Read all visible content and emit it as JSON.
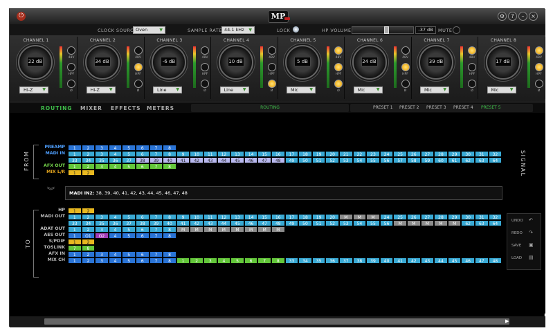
{
  "app": {
    "logo": "MP"
  },
  "topbar": {
    "clock_source_label": "CLOCK SOURCE",
    "clock_source_value": "Oven",
    "sample_rate_label": "SAMPLE RATE",
    "sample_rate_value": "44.1 kHz",
    "lock_label": "LOCK",
    "hp_volume_label": "HP VOLUME",
    "hp_volume_value": "-37 dB",
    "hp_volume_level": 0.56,
    "mute_label": "MUTE"
  },
  "channels": [
    {
      "name": "CHANNEL 1",
      "gain": "22 dB",
      "input": "Hi-Z",
      "btn48": false,
      "hpf": false,
      "phase": false
    },
    {
      "name": "CHANNEL 2",
      "gain": "34 dB",
      "input": "Hi-Z",
      "btn48": false,
      "hpf": true,
      "phase": false
    },
    {
      "name": "CHANNEL 3",
      "gain": "-6 dB",
      "input": "Line",
      "btn48": false,
      "hpf": false,
      "phase": false
    },
    {
      "name": "CHANNEL 4",
      "gain": "10 dB",
      "input": "Line",
      "btn48": false,
      "hpf": false,
      "phase": true
    },
    {
      "name": "CHANNEL 5",
      "gain": "5 dB",
      "input": "Mic",
      "btn48": true,
      "hpf": true,
      "phase": true
    },
    {
      "name": "CHANNEL 6",
      "gain": "24 dB",
      "input": "Mic",
      "btn48": false,
      "hpf": true,
      "phase": false
    },
    {
      "name": "CHANNEL 7",
      "gain": "39 dB",
      "input": "Mic",
      "btn48": true,
      "hpf": false,
      "phase": false
    },
    {
      "name": "CHANNEL 8",
      "gain": "17 dB",
      "input": "Mic",
      "btn48": true,
      "hpf": true,
      "phase": false
    }
  ],
  "channel_button_labels": {
    "p48": "48V",
    "hpf": "HPF",
    "phase": "Ø"
  },
  "tabs": [
    {
      "label": "ROUTING",
      "active": true
    },
    {
      "label": "MIXER",
      "active": false
    },
    {
      "label": "EFFECTS",
      "active": false
    },
    {
      "label": "METERS",
      "active": false
    }
  ],
  "routing_header": "ROUTING",
  "presets": [
    {
      "label": "PRESET 1",
      "active": false
    },
    {
      "label": "PRESET 2",
      "active": false
    },
    {
      "label": "PRESET 3",
      "active": false
    },
    {
      "label": "PRESET 4",
      "active": false
    },
    {
      "label": "PRESET 5",
      "active": true
    }
  ],
  "from_label": "FROM",
  "to_label": "TO",
  "signal_label": "SIGNAL",
  "colors": {
    "blue": "#2a74d6",
    "cyan": "#39a9d4",
    "lavender": "#b8b8ee",
    "green": "#63c63a",
    "yellow": "#e8b820",
    "grey": "#8c8c8c",
    "purple": "#a23db8",
    "label_blue": "#4fa0ff",
    "label_orange": "#e8a81e",
    "label_green": "#74d34a",
    "label_grey": "#bbbbbb"
  },
  "from_rows": [
    {
      "label": "PREAMP",
      "color": "#4fa0ff",
      "cells": [
        {
          "t": "1",
          "c": "blue"
        },
        {
          "t": "2",
          "c": "blue"
        },
        {
          "t": "3",
          "c": "blue"
        },
        {
          "t": "4",
          "c": "blue"
        },
        {
          "t": "5",
          "c": "blue"
        },
        {
          "t": "6",
          "c": "blue"
        },
        {
          "t": "7",
          "c": "blue"
        },
        {
          "t": "8",
          "c": "blue"
        }
      ]
    },
    {
      "label": "MADI IN",
      "color": "#4fa0ff",
      "cells": [
        {
          "t": "1",
          "c": "cyan"
        },
        {
          "t": "2",
          "c": "cyan"
        },
        {
          "t": "3",
          "c": "cyan"
        },
        {
          "t": "4",
          "c": "cyan"
        },
        {
          "t": "5",
          "c": "cyan"
        },
        {
          "t": "6",
          "c": "cyan"
        },
        {
          "t": "7",
          "c": "cyan"
        },
        {
          "t": "8",
          "c": "cyan"
        },
        {
          "t": "9",
          "c": "cyan"
        },
        {
          "t": "10",
          "c": "cyan"
        },
        {
          "t": "11",
          "c": "cyan"
        },
        {
          "t": "12",
          "c": "cyan"
        },
        {
          "t": "13",
          "c": "cyan"
        },
        {
          "t": "14",
          "c": "cyan"
        },
        {
          "t": "15",
          "c": "cyan"
        },
        {
          "t": "16",
          "c": "cyan"
        },
        {
          "t": "17",
          "c": "cyan"
        },
        {
          "t": "18",
          "c": "cyan"
        },
        {
          "t": "19",
          "c": "cyan"
        },
        {
          "t": "20",
          "c": "cyan"
        },
        {
          "t": "21",
          "c": "cyan"
        },
        {
          "t": "22",
          "c": "cyan"
        },
        {
          "t": "23",
          "c": "cyan"
        },
        {
          "t": "24",
          "c": "cyan"
        },
        {
          "t": "25",
          "c": "cyan"
        },
        {
          "t": "26",
          "c": "cyan"
        },
        {
          "t": "27",
          "c": "cyan"
        },
        {
          "t": "28",
          "c": "cyan"
        },
        {
          "t": "29",
          "c": "cyan"
        },
        {
          "t": "30",
          "c": "cyan"
        },
        {
          "t": "31",
          "c": "cyan"
        },
        {
          "t": "32",
          "c": "cyan"
        }
      ]
    },
    {
      "label": "",
      "color": "#4fa0ff",
      "cells": [
        {
          "t": "33",
          "c": "cyan"
        },
        {
          "t": "34",
          "c": "cyan"
        },
        {
          "t": "35",
          "c": "cyan"
        },
        {
          "t": "36",
          "c": "cyan"
        },
        {
          "t": "37",
          "c": "cyan"
        },
        {
          "t": "38",
          "c": "lavender"
        },
        {
          "t": "39",
          "c": "lavender"
        },
        {
          "t": "40",
          "c": "lavender"
        },
        {
          "t": "41",
          "c": "lavender"
        },
        {
          "t": "42",
          "c": "lavender"
        },
        {
          "t": "43",
          "c": "lavender"
        },
        {
          "t": "44",
          "c": "lavender"
        },
        {
          "t": "45",
          "c": "lavender"
        },
        {
          "t": "46",
          "c": "lavender"
        },
        {
          "t": "47",
          "c": "lavender"
        },
        {
          "t": "48",
          "c": "lavender"
        },
        {
          "t": "49",
          "c": "cyan"
        },
        {
          "t": "50",
          "c": "cyan"
        },
        {
          "t": "51",
          "c": "cyan"
        },
        {
          "t": "52",
          "c": "cyan"
        },
        {
          "t": "53",
          "c": "cyan"
        },
        {
          "t": "54",
          "c": "cyan"
        },
        {
          "t": "55",
          "c": "cyan"
        },
        {
          "t": "56",
          "c": "cyan"
        },
        {
          "t": "57",
          "c": "cyan"
        },
        {
          "t": "58",
          "c": "cyan"
        },
        {
          "t": "59",
          "c": "cyan"
        },
        {
          "t": "60",
          "c": "cyan"
        },
        {
          "t": "61",
          "c": "cyan"
        },
        {
          "t": "62",
          "c": "cyan"
        },
        {
          "t": "63",
          "c": "cyan"
        },
        {
          "t": "64",
          "c": "cyan"
        }
      ]
    },
    {
      "label": "AFX OUT",
      "color": "#74d34a",
      "cells": [
        {
          "t": "1",
          "c": "green"
        },
        {
          "t": "2",
          "c": "green"
        },
        {
          "t": "3",
          "c": "green"
        },
        {
          "t": "4",
          "c": "green"
        },
        {
          "t": "5",
          "c": "green"
        },
        {
          "t": "6",
          "c": "green"
        },
        {
          "t": "7",
          "c": "green"
        },
        {
          "t": "8",
          "c": "green"
        }
      ]
    },
    {
      "label": "MIX L/R",
      "color": "#e8a81e",
      "cells": [
        {
          "t": "1",
          "c": "yellow"
        },
        {
          "t": "2",
          "c": "yellow"
        }
      ]
    }
  ],
  "info_label": "MADI IN2:",
  "info_text": "38, 39, 40, 41, 42, 43, 44, 45, 46, 47, 48",
  "to_rows": [
    {
      "label": "HP",
      "color": "#bbbbbb",
      "cells": [
        {
          "t": "1",
          "c": "yellow"
        },
        {
          "t": "2",
          "c": "yellow"
        }
      ]
    },
    {
      "label": "MADI OUT",
      "color": "#bbbbbb",
      "cells": [
        {
          "t": "1",
          "c": "cyan"
        },
        {
          "t": "2",
          "c": "cyan"
        },
        {
          "t": "3",
          "c": "cyan"
        },
        {
          "t": "4",
          "c": "cyan"
        },
        {
          "t": "5",
          "c": "cyan"
        },
        {
          "t": "6",
          "c": "cyan"
        },
        {
          "t": "7",
          "c": "cyan"
        },
        {
          "t": "8",
          "c": "cyan"
        },
        {
          "t": "9",
          "c": "cyan"
        },
        {
          "t": "10",
          "c": "cyan"
        },
        {
          "t": "11",
          "c": "cyan"
        },
        {
          "t": "12",
          "c": "cyan"
        },
        {
          "t": "13",
          "c": "cyan"
        },
        {
          "t": "14",
          "c": "cyan"
        },
        {
          "t": "15",
          "c": "cyan"
        },
        {
          "t": "16",
          "c": "cyan"
        },
        {
          "t": "17",
          "c": "cyan"
        },
        {
          "t": "18",
          "c": "cyan"
        },
        {
          "t": "19",
          "c": "cyan"
        },
        {
          "t": "20",
          "c": "cyan"
        },
        {
          "t": "M",
          "c": "grey"
        },
        {
          "t": "M",
          "c": "grey"
        },
        {
          "t": "M",
          "c": "grey"
        },
        {
          "t": "24",
          "c": "cyan"
        },
        {
          "t": "25",
          "c": "cyan"
        },
        {
          "t": "26",
          "c": "cyan"
        },
        {
          "t": "27",
          "c": "cyan"
        },
        {
          "t": "28",
          "c": "cyan"
        },
        {
          "t": "29",
          "c": "cyan"
        },
        {
          "t": "30",
          "c": "cyan"
        },
        {
          "t": "31",
          "c": "cyan"
        },
        {
          "t": "32",
          "c": "cyan"
        }
      ]
    },
    {
      "label": "",
      "color": "#bbbbbb",
      "cells": [
        {
          "t": "33",
          "c": "cyan"
        },
        {
          "t": "34",
          "c": "cyan"
        },
        {
          "t": "35",
          "c": "cyan"
        },
        {
          "t": "36",
          "c": "cyan"
        },
        {
          "t": "37",
          "c": "cyan"
        },
        {
          "t": "38",
          "c": "cyan"
        },
        {
          "t": "39",
          "c": "cyan"
        },
        {
          "t": "40",
          "c": "cyan"
        },
        {
          "t": "41",
          "c": "cyan"
        },
        {
          "t": "42",
          "c": "cyan"
        },
        {
          "t": "43",
          "c": "cyan"
        },
        {
          "t": "44",
          "c": "cyan"
        },
        {
          "t": "45",
          "c": "cyan"
        },
        {
          "t": "46",
          "c": "cyan"
        },
        {
          "t": "47",
          "c": "cyan"
        },
        {
          "t": "48",
          "c": "cyan"
        },
        {
          "t": "49",
          "c": "cyan"
        },
        {
          "t": "50",
          "c": "cyan"
        },
        {
          "t": "51",
          "c": "cyan"
        },
        {
          "t": "52",
          "c": "cyan"
        },
        {
          "t": "53",
          "c": "cyan"
        },
        {
          "t": "54",
          "c": "cyan"
        },
        {
          "t": "55",
          "c": "cyan"
        },
        {
          "t": "56",
          "c": "cyan"
        },
        {
          "t": "M",
          "c": "grey"
        },
        {
          "t": "M",
          "c": "grey"
        },
        {
          "t": "M",
          "c": "grey"
        },
        {
          "t": "M",
          "c": "grey"
        },
        {
          "t": "M",
          "c": "grey"
        },
        {
          "t": "62",
          "c": "cyan"
        },
        {
          "t": "63",
          "c": "cyan"
        },
        {
          "t": "64",
          "c": "cyan"
        }
      ]
    },
    {
      "label": "ADAT OUT",
      "color": "#bbbbbb",
      "cells": [
        {
          "t": "1",
          "c": "cyan"
        },
        {
          "t": "2",
          "c": "cyan"
        },
        {
          "t": "3",
          "c": "cyan"
        },
        {
          "t": "4",
          "c": "cyan"
        },
        {
          "t": "5",
          "c": "cyan"
        },
        {
          "t": "6",
          "c": "cyan"
        },
        {
          "t": "7",
          "c": "cyan"
        },
        {
          "t": "8",
          "c": "cyan"
        },
        {
          "t": "M",
          "c": "grey"
        },
        {
          "t": "M",
          "c": "grey"
        },
        {
          "t": "M",
          "c": "grey"
        },
        {
          "t": "M",
          "c": "grey"
        },
        {
          "t": "M",
          "c": "grey"
        },
        {
          "t": "M",
          "c": "grey"
        },
        {
          "t": "M",
          "c": "grey"
        },
        {
          "t": "M",
          "c": "grey"
        }
      ]
    },
    {
      "label": "AES OUT",
      "color": "#bbbbbb",
      "cells": [
        {
          "t": "1",
          "c": "blue"
        },
        {
          "t": "O1",
          "c": "blue"
        },
        {
          "t": "O2",
          "c": "purple"
        },
        {
          "t": "4",
          "c": "blue"
        },
        {
          "t": "5",
          "c": "blue"
        },
        {
          "t": "6",
          "c": "blue"
        },
        {
          "t": "7",
          "c": "blue"
        },
        {
          "t": "8",
          "c": "blue"
        }
      ]
    },
    {
      "label": "S/PDIF",
      "color": "#bbbbbb",
      "cells": [
        {
          "t": "1",
          "c": "yellow"
        },
        {
          "t": "2",
          "c": "yellow"
        }
      ]
    },
    {
      "label": "TOSLINK",
      "color": "#bbbbbb",
      "cells": [
        {
          "t": "7",
          "c": "green"
        },
        {
          "t": "8",
          "c": "green"
        }
      ]
    },
    {
      "label": "AFX IN",
      "color": "#bbbbbb",
      "cells": [
        {
          "t": "1",
          "c": "blue"
        },
        {
          "t": "2",
          "c": "blue"
        },
        {
          "t": "3",
          "c": "blue"
        },
        {
          "t": "4",
          "c": "blue"
        },
        {
          "t": "5",
          "c": "blue"
        },
        {
          "t": "6",
          "c": "blue"
        },
        {
          "t": "7",
          "c": "blue"
        },
        {
          "t": "8",
          "c": "blue"
        }
      ]
    },
    {
      "label": "MIX CH",
      "color": "#bbbbbb",
      "cells": [
        {
          "t": "1",
          "c": "blue"
        },
        {
          "t": "2",
          "c": "blue"
        },
        {
          "t": "3",
          "c": "blue"
        },
        {
          "t": "4",
          "c": "blue"
        },
        {
          "t": "5",
          "c": "blue"
        },
        {
          "t": "6",
          "c": "blue"
        },
        {
          "t": "7",
          "c": "blue"
        },
        {
          "t": "8",
          "c": "blue"
        },
        {
          "t": "1",
          "c": "green"
        },
        {
          "t": "2",
          "c": "green"
        },
        {
          "t": "3",
          "c": "green"
        },
        {
          "t": "4",
          "c": "green"
        },
        {
          "t": "5",
          "c": "green"
        },
        {
          "t": "6",
          "c": "green"
        },
        {
          "t": "7",
          "c": "green"
        },
        {
          "t": "8",
          "c": "green"
        },
        {
          "t": "33",
          "c": "cyan"
        },
        {
          "t": "34",
          "c": "cyan"
        },
        {
          "t": "35",
          "c": "cyan"
        },
        {
          "t": "36",
          "c": "cyan"
        },
        {
          "t": "37",
          "c": "cyan"
        },
        {
          "t": "38",
          "c": "cyan"
        },
        {
          "t": "39",
          "c": "cyan"
        },
        {
          "t": "40",
          "c": "cyan"
        },
        {
          "t": "41",
          "c": "cyan"
        },
        {
          "t": "42",
          "c": "cyan"
        },
        {
          "t": "43",
          "c": "cyan"
        },
        {
          "t": "44",
          "c": "cyan"
        },
        {
          "t": "45",
          "c": "cyan"
        },
        {
          "t": "46",
          "c": "cyan"
        },
        {
          "t": "47",
          "c": "cyan"
        },
        {
          "t": "48",
          "c": "cyan"
        }
      ]
    }
  ],
  "side_buttons": [
    {
      "label": "UNDO",
      "icon": "undo-icon",
      "glyph": "↶"
    },
    {
      "label": "REDO",
      "icon": "redo-icon",
      "glyph": "↷"
    },
    {
      "label": "SAVE",
      "icon": "save-icon",
      "glyph": "▣"
    },
    {
      "label": "LOAD",
      "icon": "load-icon",
      "glyph": "▤"
    }
  ]
}
